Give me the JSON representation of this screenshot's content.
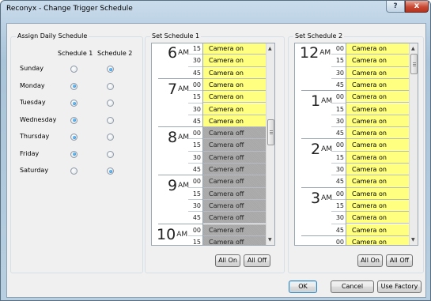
{
  "window": {
    "title": "Reconyx - Change Trigger Schedule",
    "help_label": "?",
    "close_label": "x"
  },
  "assign": {
    "group_label": "Assign Daily Schedule",
    "col1": "Schedule 1",
    "col2": "Schedule 2",
    "days": [
      {
        "name": "Sunday",
        "selected": 2
      },
      {
        "name": "Monday",
        "selected": 1
      },
      {
        "name": "Tuesday",
        "selected": 1
      },
      {
        "name": "Wednesday",
        "selected": 1
      },
      {
        "name": "Thursday",
        "selected": 1
      },
      {
        "name": "Friday",
        "selected": 1
      },
      {
        "name": "Saturday",
        "selected": 2
      }
    ]
  },
  "schedule1": {
    "group_label": "Set Schedule 1",
    "rows": [
      {
        "hour": "6",
        "ampm": "AM",
        "minute": "15",
        "status": "Camera on"
      },
      {
        "hour": "",
        "ampm": "",
        "minute": "30",
        "status": "Camera on"
      },
      {
        "hour": "",
        "ampm": "",
        "minute": "45",
        "status": "Camera on"
      },
      {
        "hour": "7",
        "ampm": "AM",
        "minute": "00",
        "status": "Camera on"
      },
      {
        "hour": "",
        "ampm": "",
        "minute": "15",
        "status": "Camera on"
      },
      {
        "hour": "",
        "ampm": "",
        "minute": "30",
        "status": "Camera on"
      },
      {
        "hour": "",
        "ampm": "",
        "minute": "45",
        "status": "Camera on"
      },
      {
        "hour": "8",
        "ampm": "AM",
        "minute": "00",
        "status": "Camera off"
      },
      {
        "hour": "",
        "ampm": "",
        "minute": "15",
        "status": "Camera off"
      },
      {
        "hour": "",
        "ampm": "",
        "minute": "30",
        "status": "Camera off"
      },
      {
        "hour": "",
        "ampm": "",
        "minute": "45",
        "status": "Camera off"
      },
      {
        "hour": "9",
        "ampm": "AM",
        "minute": "00",
        "status": "Camera off"
      },
      {
        "hour": "",
        "ampm": "",
        "minute": "15",
        "status": "Camera off"
      },
      {
        "hour": "",
        "ampm": "",
        "minute": "30",
        "status": "Camera off"
      },
      {
        "hour": "",
        "ampm": "",
        "minute": "45",
        "status": "Camera off"
      },
      {
        "hour": "10",
        "ampm": "AM",
        "minute": "00",
        "status": "Camera off"
      },
      {
        "hour": "",
        "ampm": "",
        "minute": "15",
        "status": "Camera off"
      }
    ],
    "all_on": "All On",
    "all_off": "All Off"
  },
  "schedule2": {
    "group_label": "Set Schedule 2",
    "rows": [
      {
        "hour": "12",
        "ampm": "AM",
        "minute": "00",
        "status": "Camera on"
      },
      {
        "hour": "",
        "ampm": "",
        "minute": "15",
        "status": "Camera on"
      },
      {
        "hour": "",
        "ampm": "",
        "minute": "30",
        "status": "Camera on"
      },
      {
        "hour": "",
        "ampm": "",
        "minute": "45",
        "status": "Camera on"
      },
      {
        "hour": "1",
        "ampm": "AM",
        "minute": "00",
        "status": "Camera on"
      },
      {
        "hour": "",
        "ampm": "",
        "minute": "15",
        "status": "Camera on"
      },
      {
        "hour": "",
        "ampm": "",
        "minute": "30",
        "status": "Camera on"
      },
      {
        "hour": "",
        "ampm": "",
        "minute": "45",
        "status": "Camera on"
      },
      {
        "hour": "2",
        "ampm": "AM",
        "minute": "00",
        "status": "Camera on"
      },
      {
        "hour": "",
        "ampm": "",
        "minute": "15",
        "status": "Camera on"
      },
      {
        "hour": "",
        "ampm": "",
        "minute": "30",
        "status": "Camera on"
      },
      {
        "hour": "",
        "ampm": "",
        "minute": "45",
        "status": "Camera on"
      },
      {
        "hour": "3",
        "ampm": "AM",
        "minute": "00",
        "status": "Camera on"
      },
      {
        "hour": "",
        "ampm": "",
        "minute": "15",
        "status": "Camera on"
      },
      {
        "hour": "",
        "ampm": "",
        "minute": "30",
        "status": "Camera on"
      },
      {
        "hour": "",
        "ampm": "",
        "minute": "45",
        "status": "Camera on"
      },
      {
        "hour": "",
        "ampm": "",
        "minute": "00",
        "status": "Camera on"
      }
    ],
    "all_on": "All On",
    "all_off": "All Off"
  },
  "footer": {
    "ok": "OK",
    "cancel": "Cancel",
    "use_factory": "Use Factory"
  },
  "colors": {
    "camera_on": "#ffff80",
    "camera_off": "#a7a7a7",
    "radio_selected": "#1e78c2"
  },
  "icons": {
    "scroll_up": "scroll-up-arrow-icon",
    "scroll_down": "scroll-down-arrow-icon"
  }
}
